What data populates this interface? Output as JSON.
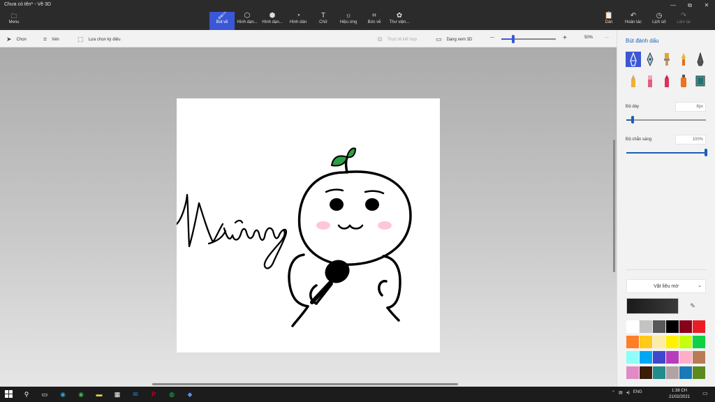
{
  "window": {
    "title": "Chưa có tên* - Vẽ 3D",
    "controls": [
      "—",
      "⧉",
      "✕"
    ]
  },
  "ribbon": {
    "menu_label": "Menu",
    "tools": [
      {
        "label": "Bút vẽ",
        "icon": "brush-icon"
      },
      {
        "label": "Hình dạn...",
        "icon": "2d-shapes-icon"
      },
      {
        "label": "Hình dạn...",
        "icon": "3d-shapes-icon"
      },
      {
        "label": "Hình dán",
        "icon": "stickers-icon"
      },
      {
        "label": "Chữ",
        "icon": "text-icon"
      },
      {
        "label": "Hiệu ứng",
        "icon": "effects-icon"
      },
      {
        "label": "Bức vẽ",
        "icon": "canvas-icon"
      },
      {
        "label": "Thư viện...",
        "icon": "3d-library-icon"
      }
    ],
    "right_tools": [
      {
        "label": "Dán",
        "icon": "paste-icon"
      },
      {
        "label": "Hoàn tác",
        "icon": "undo-icon"
      },
      {
        "label": "Lịch sử",
        "icon": "history-icon"
      },
      {
        "label": "Làm lại",
        "icon": "redo-icon"
      }
    ]
  },
  "subbar": {
    "select": "Chọn",
    "crop": "Xén",
    "magic_select": "Lựa chọn kỳ diệu",
    "mixed_reality": "Thực tế kết hợp",
    "view_3d": "Dạng xem 3D",
    "zoom_minus": "—",
    "zoom_plus": "+",
    "zoom": "50%",
    "zoom_level": 0.22,
    "more": "···"
  },
  "canvas": {
    "handwriting": "Hương"
  },
  "panel": {
    "title": "Bút đánh dấu",
    "brushes": [
      "marker-icon",
      "calligraphy-pen-icon",
      "oil-brush-icon",
      "watercolor-icon",
      "pixel-pen-icon",
      "pencil-icon",
      "eraser-icon",
      "crayon-icon",
      "spraycan-icon",
      "fill-icon"
    ],
    "selected_brush": 0,
    "thickness_label": "Độ dày",
    "thickness_value": "8px",
    "thickness_level": 0.08,
    "opacity_label": "Độ chắn sáng",
    "opacity_value": "100%",
    "opacity_level": 1.0,
    "material": "Vật liệu mờ",
    "current_color": "#1a1a1a",
    "swatches": [
      "#ffffff",
      "#c3c3c3",
      "#585858",
      "#000000",
      "#88001b",
      "#ec1c24",
      "#ff7f27",
      "#ffca18",
      "#fdeca6",
      "#fff200",
      "#c4ff0e",
      "#0ed145",
      "#8cfffb",
      "#00a8f3",
      "#3f48cc",
      "#b83dba",
      "#ffaec8",
      "#b97a56",
      "#e08bc5",
      "#3b1e08",
      "#208c8c",
      "#b0a3a3",
      "#1a79b8",
      "#5c8a1e"
    ]
  },
  "taskbar": {
    "apps": [
      {
        "name": "search-icon",
        "glyph": "⚲",
        "color": "#ffffff"
      },
      {
        "name": "task-view-icon",
        "glyph": "▭",
        "color": "#ffffff"
      },
      {
        "name": "edge-icon",
        "glyph": "◉",
        "color": "#2fa3d6"
      },
      {
        "name": "chrome-icon",
        "glyph": "◉",
        "color": "#4caf50"
      },
      {
        "name": "file-explorer-icon",
        "glyph": "▬",
        "color": "#f2c94c"
      },
      {
        "name": "store-icon",
        "glyph": "▦",
        "color": "#ffffff"
      },
      {
        "name": "mail-icon",
        "glyph": "✉",
        "color": "#2b88d8"
      },
      {
        "name": "pinterest-icon",
        "glyph": "P",
        "color": "#e60023"
      },
      {
        "name": "spotify-icon",
        "glyph": "◍",
        "color": "#1db954"
      },
      {
        "name": "paint-3d-icon",
        "glyph": "◆",
        "color": "#5b8dee"
      }
    ],
    "language": "ENG",
    "time": "1:38 CH",
    "date": "21/02/2021"
  }
}
